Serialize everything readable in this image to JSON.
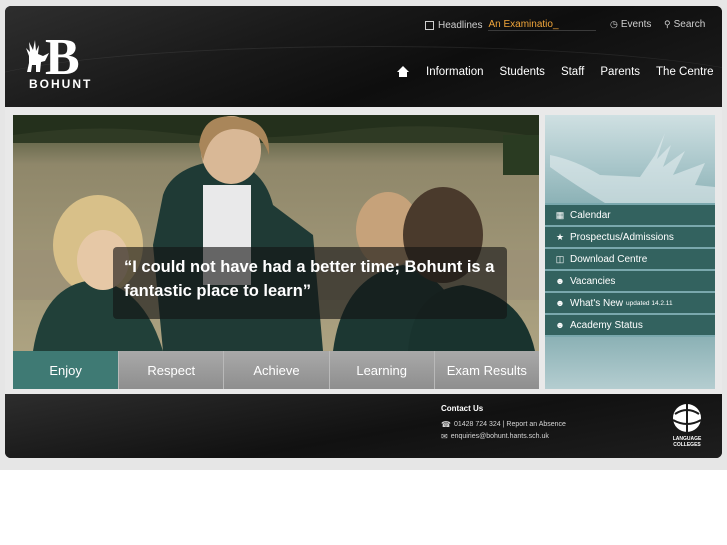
{
  "brand": {
    "name": "BOHUNT",
    "logo_letter": "B"
  },
  "topbar": {
    "headlines_label": "Headlines",
    "headline_ticker": "An Examinatio_",
    "events_label": "Events",
    "search_label": "Search"
  },
  "nav": {
    "items": [
      "Information",
      "Students",
      "Staff",
      "Parents",
      "The Centre"
    ]
  },
  "hero": {
    "quote": "“I could not have had a better time; Bohunt is a fantastic place to learn”"
  },
  "tabs": [
    "Enjoy",
    "Respect",
    "Achieve",
    "Learning",
    "Exam Results"
  ],
  "side_menu": [
    {
      "label": "Calendar",
      "icon": "calendar-icon",
      "note": ""
    },
    {
      "label": "Prospectus/Admissions",
      "icon": "star-icon",
      "note": ""
    },
    {
      "label": "Download Centre",
      "icon": "document-icon",
      "note": ""
    },
    {
      "label": "Vacancies",
      "icon": "people-icon",
      "note": ""
    },
    {
      "label": "What's New",
      "icon": "people-icon",
      "note": "updated 14.2.11"
    },
    {
      "label": "Academy Status",
      "icon": "people-icon",
      "note": ""
    }
  ],
  "footer": {
    "contact_title": "Contact Us",
    "phone_line": "01428 724 324 | Report an Absence",
    "email_line": "enquiries@bohunt.hants.sch.uk",
    "badge_text": "LANGUAGE COLLEGES"
  },
  "colors": {
    "accent_teal": "#3f7a74",
    "menu_teal": "#33625f",
    "ticker_orange": "#f0a53a"
  }
}
